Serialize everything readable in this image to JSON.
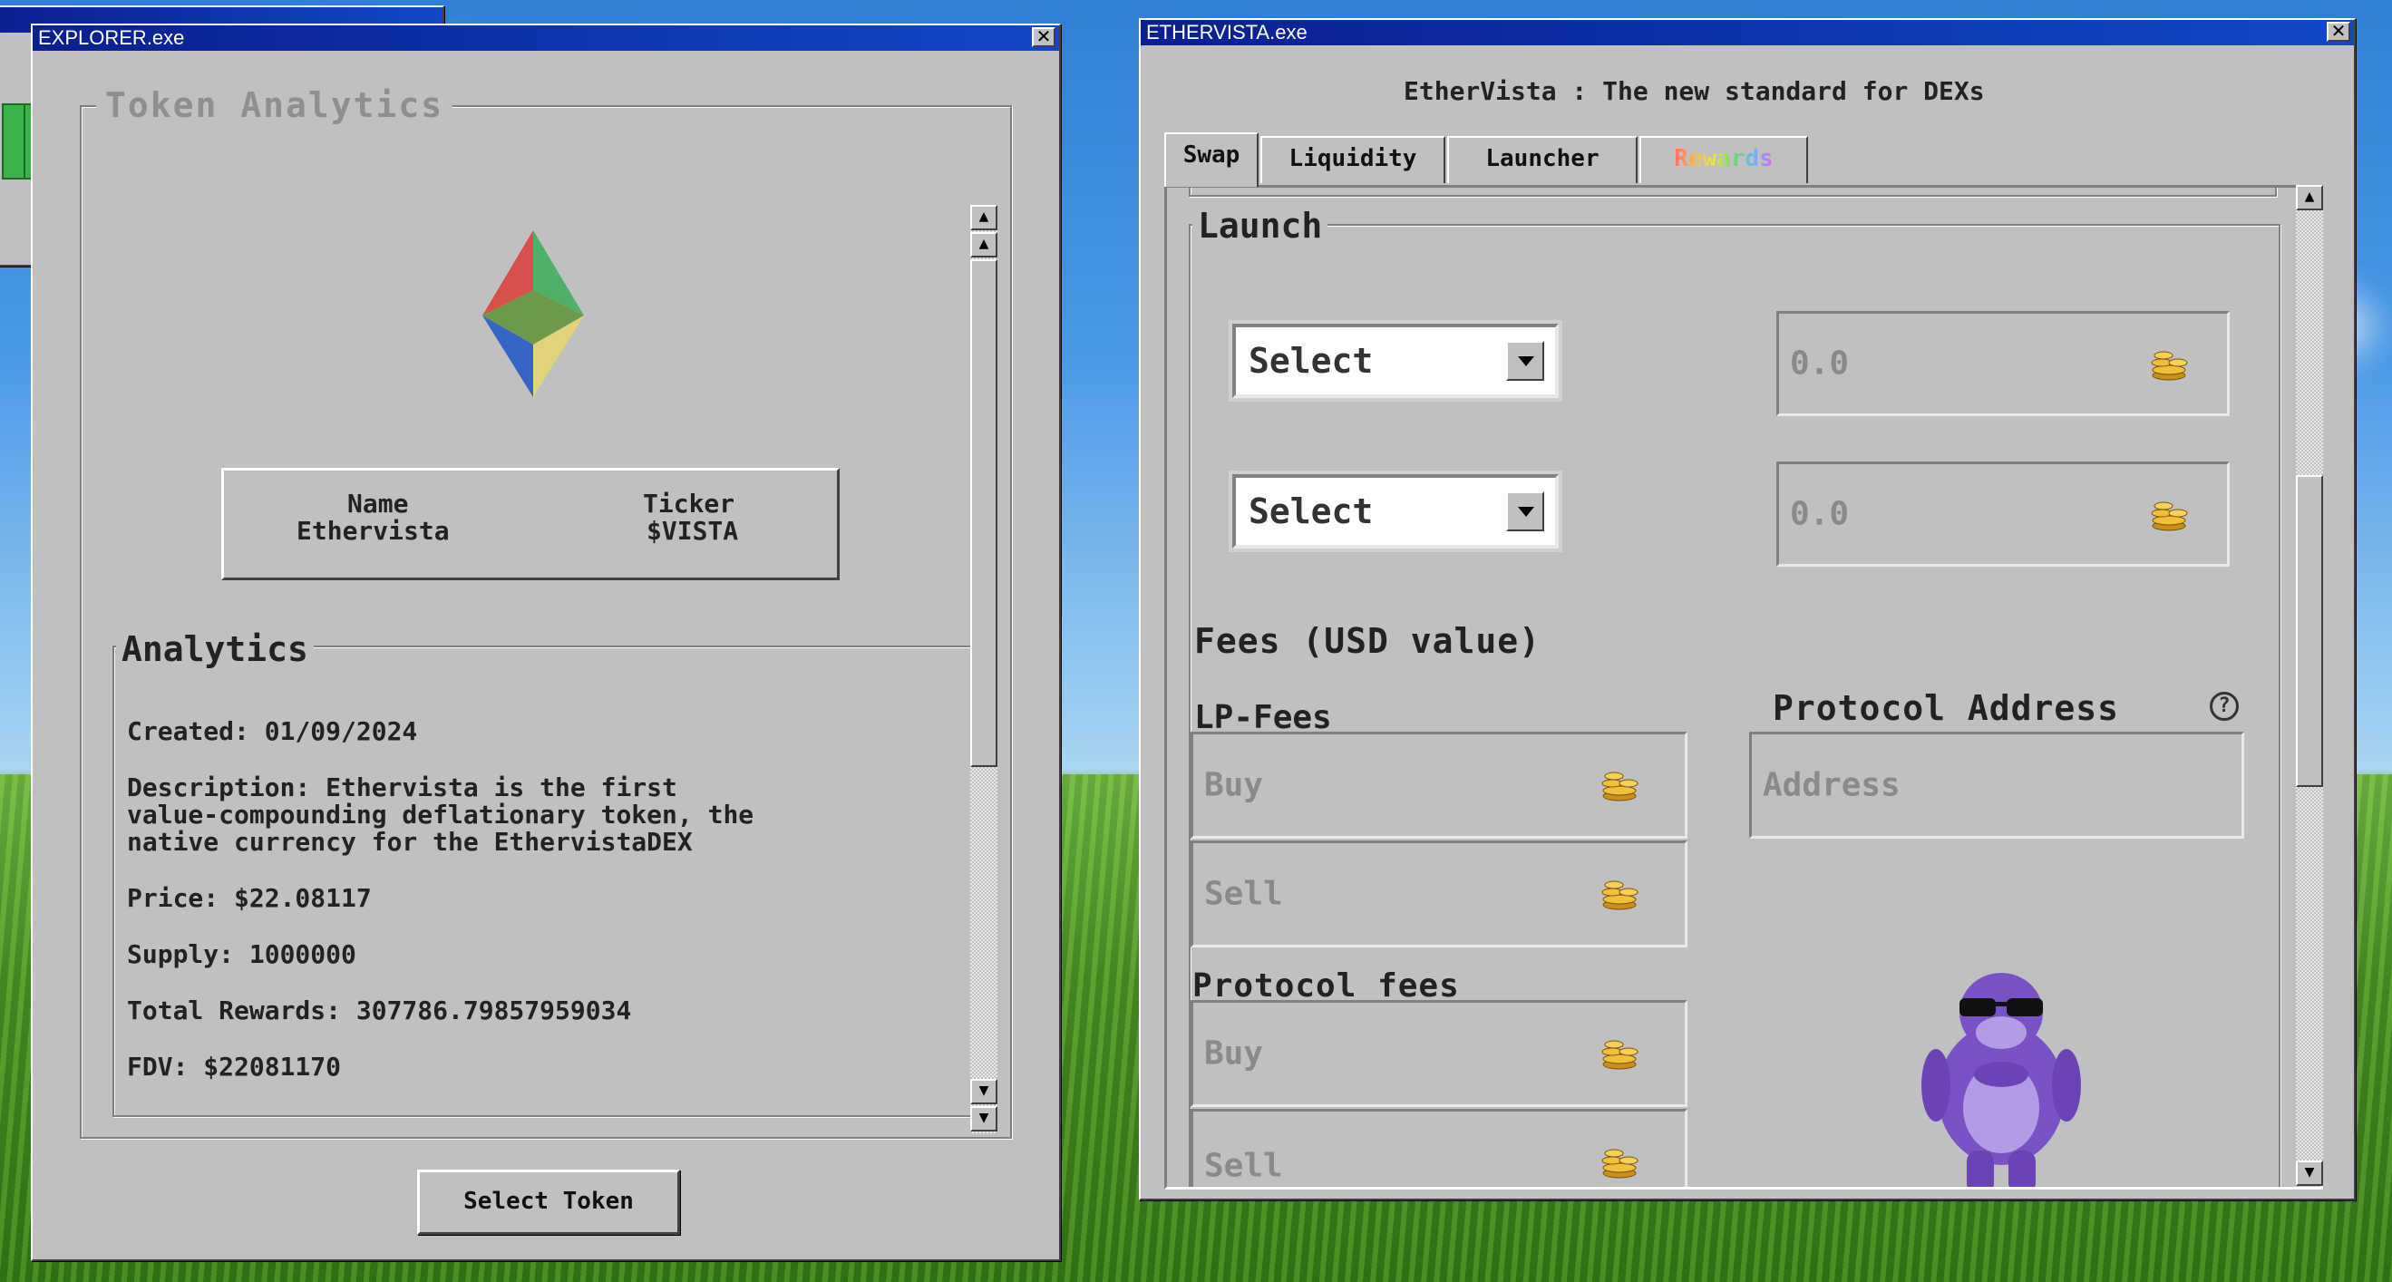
{
  "explorer": {
    "title": "EXPLORER.exe",
    "section_title": "Token Analytics",
    "name_header": "Name",
    "name_value": "Ethervista",
    "ticker_header": "Ticker",
    "ticker_value": "$VISTA",
    "analytics_title": "Analytics",
    "created": "Created: 01/09/2024",
    "description_lines": [
      "Description: Ethervista is the first",
      "value-compounding deflationary token, the",
      "native currency for the EthervistaDEX"
    ],
    "price": "Price: $22.08117",
    "supply": "Supply: 1000000",
    "total_rewards": "Total Rewards: 307786.79857959034",
    "fdv": "FDV: $22081170",
    "select_token_button": "Select Token"
  },
  "ethervista": {
    "title": "ETHERVISTA.exe",
    "headline": "EtherVista : The new standard for DEXs",
    "tabs": [
      {
        "label": "Swap",
        "active": true
      },
      {
        "label": "Liquidity",
        "active": false
      },
      {
        "label": "Launcher",
        "active": false
      },
      {
        "label": "Rewards",
        "active": false
      }
    ],
    "launch_title": "Launch",
    "select_1": "Select",
    "select_2": "Select",
    "amount_1_placeholder": "0.0",
    "amount_2_placeholder": "0.0",
    "fees_title": "Fees (USD value)",
    "lp_fees_title": "LP-Fees",
    "lp_buy_placeholder": "Buy",
    "lp_sell_placeholder": "Sell",
    "protocol_address_title": "Protocol Address",
    "protocol_address_help": "?",
    "protocol_address_placeholder": "Address",
    "protocol_fees_title": "Protocol fees",
    "pf_buy_placeholder": "Buy",
    "pf_sell_placeholder": "Sell"
  },
  "colors": {
    "title_bar": "#0a1f8f",
    "window_face": "#c0c0c0",
    "rewards_tab_rainbow": "#ff6a6a",
    "mascot_purple": "#7a52c8"
  }
}
